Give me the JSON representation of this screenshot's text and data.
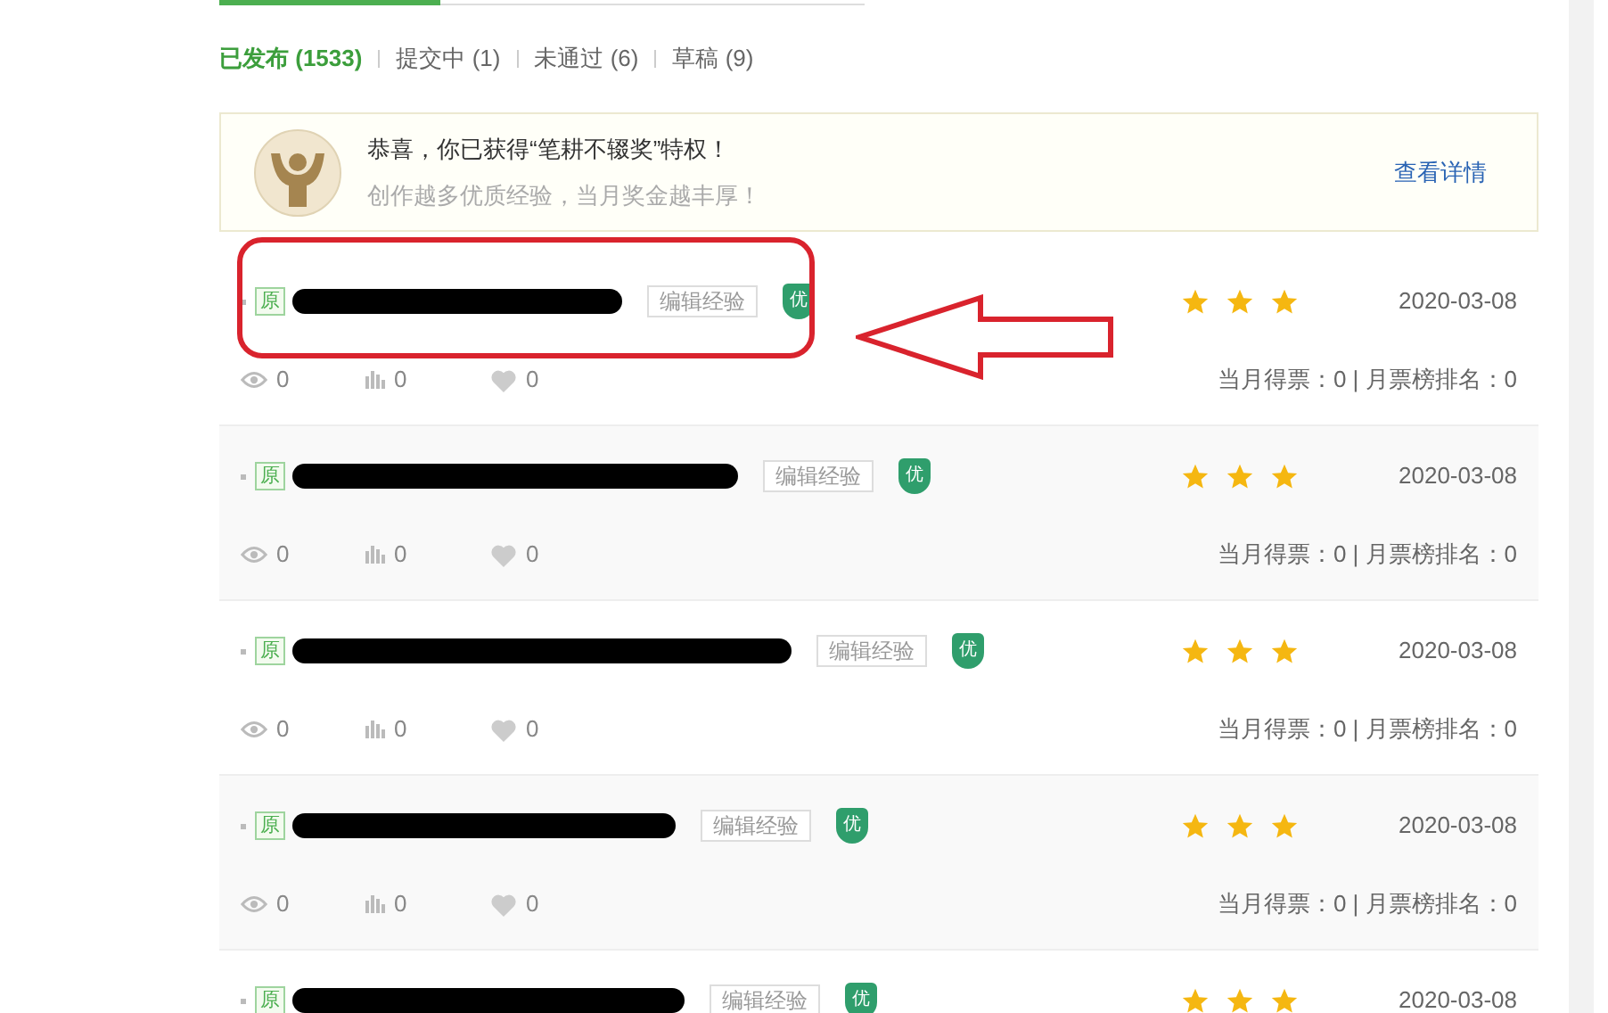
{
  "tabs": [
    {
      "label": "已发布 (1533)",
      "selected": true
    },
    {
      "label": "提交中 (1)",
      "selected": false
    },
    {
      "label": "未通过 (6)",
      "selected": false
    },
    {
      "label": "草稿 (9)",
      "selected": false
    }
  ],
  "notice": {
    "title": "恭喜，你已获得“笔耕不辍奖”特权！",
    "subtitle": "创作越多优质经验，当月奖金越丰厚！",
    "link": "查看详情"
  },
  "rows": [
    {
      "highlighted": true,
      "tag": "原",
      "edit": "编辑经验",
      "badge": "优",
      "stars": 3,
      "date": "2020-03-08",
      "views": "0",
      "votes": "0",
      "likes": "0",
      "ranking": "当月得票：0 | 月票榜排名：0"
    },
    {
      "highlighted": false,
      "tag": "原",
      "edit": "编辑经验",
      "badge": "优",
      "stars": 3,
      "date": "2020-03-08",
      "views": "0",
      "votes": "0",
      "likes": "0",
      "ranking": "当月得票：0 | 月票榜排名：0"
    },
    {
      "highlighted": false,
      "tag": "原",
      "edit": "编辑经验",
      "badge": "优",
      "stars": 3,
      "date": "2020-03-08",
      "views": "0",
      "votes": "0",
      "likes": "0",
      "ranking": "当月得票：0 | 月票榜排名：0"
    },
    {
      "highlighted": false,
      "tag": "原",
      "edit": "编辑经验",
      "badge": "优",
      "stars": 3,
      "date": "2020-03-08",
      "views": "0",
      "votes": "0",
      "likes": "0",
      "ranking": "当月得票：0 | 月票榜排名：0"
    },
    {
      "highlighted": false,
      "tag": "原",
      "edit": "编辑经验",
      "badge": "优",
      "stars": 3,
      "date": "2020-03-08"
    }
  ]
}
